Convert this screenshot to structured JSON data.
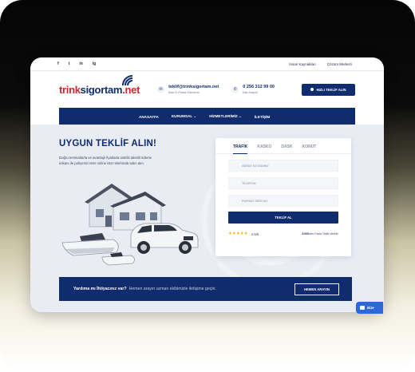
{
  "topbar": {
    "social": [
      "f",
      "t",
      "in",
      "ig"
    ],
    "links": [
      "İnsan Kaynakları",
      "Çözüm Merkezi"
    ]
  },
  "header": {
    "logo": {
      "part1": "trink",
      "part2": "sigortam",
      "part3": ".net"
    },
    "email": {
      "value": "teklif@trinksigortam.net",
      "caption": "Bize E-Posta Gönderin"
    },
    "phone": {
      "value": "0 256 312 99 00",
      "caption": "Bizi Arayın!"
    },
    "quote_button": "HIZLI TEKLİF ALIN"
  },
  "nav": {
    "items": [
      "ANASAYFA",
      "KURUMSAL ⌄",
      "HİZMETLERİMİZ ⌄",
      "İLETİŞİM"
    ]
  },
  "hero": {
    "title": "UYGUN TEKLİF ALIN!",
    "description": "Doğru teminatlarla ve avantajlı fiyatlarla üstelik taksitli ödeme imkanı ile poliçenizi ister online ister telefonda satın alın."
  },
  "form": {
    "tabs": [
      "TRAFİK",
      "KASKO",
      "DASK",
      "KONUT"
    ],
    "active_tab": "TRAFİK",
    "fields": [
      "ADINIZ SOYADINIZ",
      "TELEFON",
      "RUHSAT SERİ NO."
    ],
    "submit": "TEKLİF AL",
    "rating": {
      "stars": "★★★★★",
      "score": "4.5/5"
    },
    "reviews": {
      "count": "5.000",
      "text": "den Fazla Teklif Verildi!"
    }
  },
  "banner": {
    "question": "Yardıma mı İhtiyacınız var?",
    "subtitle": "Hemen arayın uzman ekibimizle iletişime geçin.",
    "button": "HEMEN ARAYIN"
  },
  "chat": {
    "label": "Bize"
  },
  "colors": {
    "brand": "#0e2c6e",
    "accent": "#d6232b",
    "star": "#f4b41a"
  }
}
